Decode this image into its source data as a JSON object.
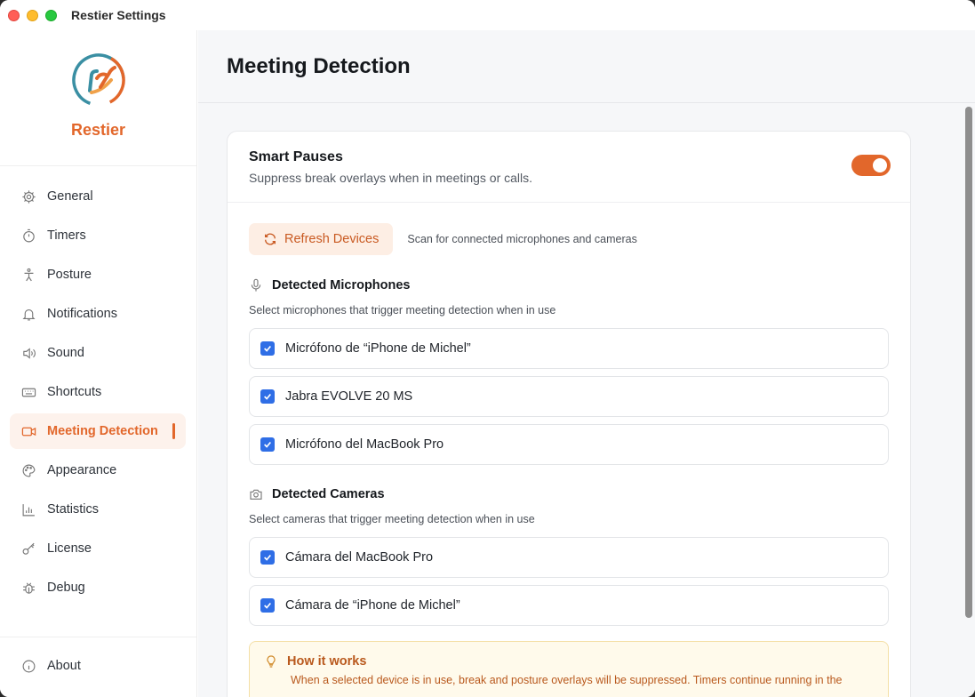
{
  "window": {
    "title": "Restier Settings"
  },
  "brand": {
    "name": "Restier",
    "accent": "#e2672b"
  },
  "sidebar": {
    "items": [
      {
        "label": "General",
        "icon": "gear-icon"
      },
      {
        "label": "Timers",
        "icon": "stopwatch-icon"
      },
      {
        "label": "Posture",
        "icon": "person-icon"
      },
      {
        "label": "Notifications",
        "icon": "bell-icon"
      },
      {
        "label": "Sound",
        "icon": "speaker-icon"
      },
      {
        "label": "Shortcuts",
        "icon": "keyboard-icon"
      },
      {
        "label": "Meeting Detection",
        "icon": "video-camera-icon",
        "active": true
      },
      {
        "label": "Appearance",
        "icon": "palette-icon"
      },
      {
        "label": "Statistics",
        "icon": "bar-chart-icon"
      },
      {
        "label": "License",
        "icon": "key-icon"
      },
      {
        "label": "Debug",
        "icon": "bug-icon"
      }
    ],
    "about": {
      "label": "About",
      "icon": "info-icon"
    }
  },
  "main": {
    "title": "Meeting Detection",
    "smart_pauses": {
      "title": "Smart Pauses",
      "subtitle": "Suppress break overlays when in meetings or calls.",
      "enabled": true
    },
    "refresh": {
      "label": "Refresh Devices",
      "hint": "Scan for connected microphones and cameras"
    },
    "microphones": {
      "title": "Detected Microphones",
      "description": "Select microphones that trigger meeting detection when in use",
      "devices": [
        {
          "label": "Micrófono de “iPhone de Michel”",
          "checked": true
        },
        {
          "label": "Jabra EVOLVE 20 MS",
          "checked": true
        },
        {
          "label": "Micrófono del MacBook Pro",
          "checked": true
        }
      ]
    },
    "cameras": {
      "title": "Detected Cameras",
      "description": "Select cameras that trigger meeting detection when in use",
      "devices": [
        {
          "label": "Cámara del MacBook Pro",
          "checked": true
        },
        {
          "label": "Cámara de “iPhone de Michel”",
          "checked": true
        }
      ]
    },
    "info": {
      "title": "How it works",
      "text": "When a selected device is in use, break and posture overlays will be suppressed. Timers continue running in the"
    }
  }
}
